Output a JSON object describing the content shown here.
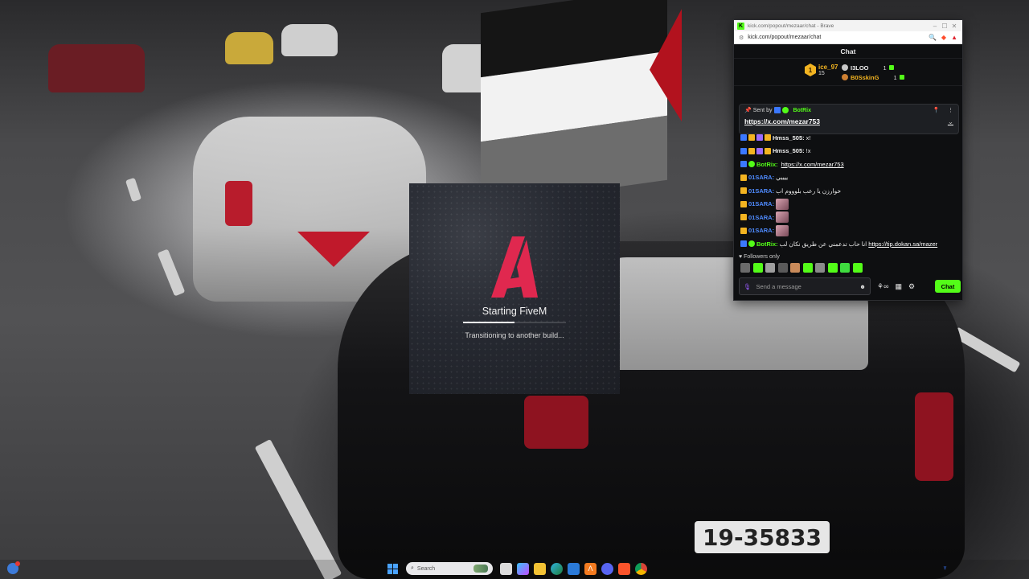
{
  "wallpaper": {
    "plate_text": "19-35833"
  },
  "fivem": {
    "title": "Starting FiveM",
    "status": "Transitioning to another build...",
    "progress_percent": 50,
    "logo_color": "#e0284f"
  },
  "browser": {
    "window_title": "kick.com/popout/mezaar/chat - Brave",
    "favicon_letter": "K",
    "url": "kick.com/popout/mezaar/chat",
    "chat_title": "Chat",
    "leaderboard": {
      "top_name": "ice_97",
      "top_rank": "1",
      "top_sub": "15",
      "entries": [
        {
          "name": "I3LOO",
          "count": "1",
          "color": "#f0f0f0",
          "medal": "#c8c8c8"
        },
        {
          "name": "B0SskinG",
          "count": "1",
          "color": "#f3b421",
          "medal": "#cd7f32"
        }
      ]
    },
    "pinned": {
      "sent_by_label": "Sent by",
      "sender": "BotRix",
      "link": "https://x.com/mezar753"
    },
    "messages": [
      {
        "icons": [
          "tw",
          "cr",
          "sub",
          "cr"
        ],
        "user": "Hmss_505",
        "user_class": "u-hmss",
        "text": "x!",
        "link": "",
        "emote": false
      },
      {
        "icons": [
          "tw",
          "cr",
          "sub",
          "cr"
        ],
        "user": "Hmss_505",
        "user_class": "u-hmss",
        "text": "!x",
        "link": "",
        "emote": false
      },
      {
        "icons": [
          "tw",
          "vg"
        ],
        "user": "BotRix",
        "user_class": "u-bot",
        "text": "",
        "link": "https://x.com/mezar753",
        "emote": false
      },
      {
        "icons": [
          "cr"
        ],
        "user": "01SARA",
        "user_class": "u-sara",
        "text": "ييييي",
        "link": "",
        "emote": false
      },
      {
        "icons": [
          "cr"
        ],
        "user": "01SARA",
        "user_class": "u-sara",
        "text": "خوارزن يا رعب بلوووم اب",
        "link": "",
        "emote": false
      },
      {
        "icons": [
          "cr"
        ],
        "user": "01SARA",
        "user_class": "u-sara",
        "text": "",
        "link": "",
        "emote": true
      },
      {
        "icons": [
          "cr"
        ],
        "user": "01SARA",
        "user_class": "u-sara",
        "text": "",
        "link": "",
        "emote": true
      },
      {
        "icons": [
          "cr"
        ],
        "user": "01SARA",
        "user_class": "u-sara",
        "text": "",
        "link": "",
        "emote": true
      },
      {
        "icons": [
          "tw",
          "vg"
        ],
        "user": "BotRix",
        "user_class": "u-bot",
        "text": "انا حاب تدعمني عن طريق نكان لب",
        "link": "https://tip.dokan.sa/mazer",
        "emote": false
      }
    ],
    "followers_only": "Followers only",
    "input_placeholder": "Send a message",
    "chat_button": "Chat",
    "emote_colors": [
      "#6b6b6b",
      "#53fc18",
      "#9e9e9e",
      "#5a5a5a",
      "#c88a5a",
      "#53fc18",
      "#8a8a8a",
      "#53fc18",
      "#3fdc3f",
      "#53fc18"
    ]
  },
  "taskbar": {
    "search_placeholder": "Search",
    "apps": [
      "file-explorer",
      "copilot",
      "folder",
      "edge",
      "app",
      "fivem",
      "discord",
      "brave",
      "chrome"
    ]
  }
}
